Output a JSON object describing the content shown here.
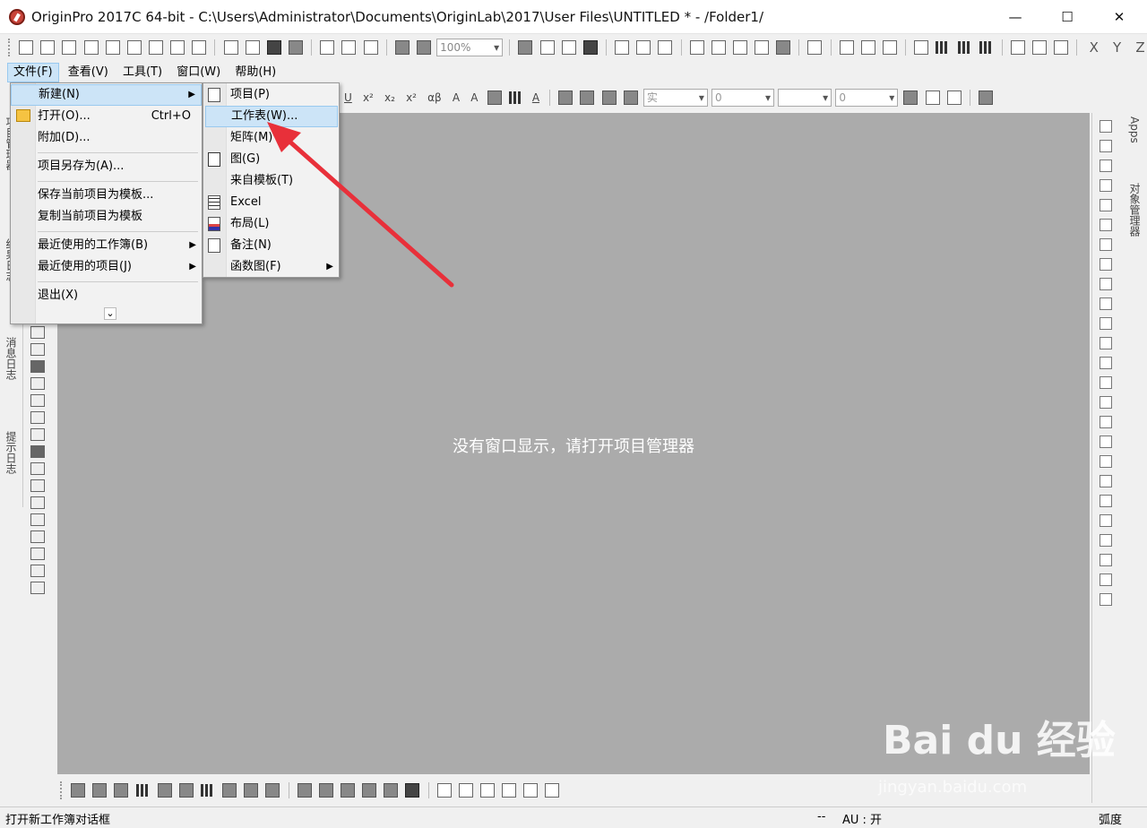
{
  "window": {
    "title": "OriginPro 2017C 64-bit - C:\\Users\\Administrator\\Documents\\OriginLab\\2017\\User Files\\UNTITLED * - /Folder1/",
    "minimize_glyph": "—",
    "maximize_glyph": "☐",
    "close_glyph": "✕"
  },
  "toolbar1": {
    "zoom_value": "100%",
    "axis_labels": [
      "X",
      "Y",
      "Z"
    ]
  },
  "menubar": {
    "items": [
      "文件(F)",
      "查看(V)",
      "工具(T)",
      "窗口(W)",
      "帮助(H)"
    ]
  },
  "toolbar2": {
    "line_style_value": "实",
    "size_field_1": "0",
    "size_field_2": "0"
  },
  "file_menu": {
    "items": [
      {
        "label": "新建(N)",
        "shortcut": "",
        "has_submenu": true
      },
      {
        "label": "打开(O)...",
        "shortcut": "Ctrl+O",
        "has_submenu": false
      },
      {
        "label": "附加(D)...",
        "shortcut": "",
        "has_submenu": false
      },
      {
        "label": "项目另存为(A)...",
        "shortcut": "",
        "has_submenu": false
      },
      {
        "label": "保存当前项目为模板...",
        "shortcut": "",
        "has_submenu": false
      },
      {
        "label": "复制当前项目为模板",
        "shortcut": "",
        "has_submenu": false
      },
      {
        "label": "最近使用的工作簿(B)",
        "shortcut": "",
        "has_submenu": true
      },
      {
        "label": "最近使用的项目(J)",
        "shortcut": "",
        "has_submenu": true
      },
      {
        "label": "退出(X)",
        "shortcut": "",
        "has_submenu": false
      }
    ],
    "expand_glyph": "⌄"
  },
  "new_submenu": {
    "items": [
      {
        "label": "项目(P)",
        "icon": "document-icon"
      },
      {
        "label": "工作表(W)...",
        "icon": "worksheet-icon"
      },
      {
        "label": "矩阵(M)",
        "icon": "matrix-icon"
      },
      {
        "label": "图(G)",
        "icon": "graph-icon"
      },
      {
        "label": "来自模板(T)",
        "icon": "template-icon"
      },
      {
        "label": "Excel",
        "icon": "excel-icon"
      },
      {
        "label": "布局(L)",
        "icon": "layout-icon"
      },
      {
        "label": "备注(N)",
        "icon": "notes-icon"
      },
      {
        "label": "函数图(F)",
        "icon": "function-plot-icon"
      }
    ]
  },
  "workspace": {
    "empty_message": "没有窗口显示，请打开项目管理器"
  },
  "left_dock": {
    "tabs": [
      "项目管理器",
      "结果日志",
      "消息日志",
      "提示日志"
    ]
  },
  "right_dock": {
    "tabs": [
      "Apps",
      "对象管理器"
    ]
  },
  "statusbar": {
    "message": "打开新工作簿对话框",
    "dashes": "--",
    "au": "AU : 开",
    "angle_unit": "弧度"
  },
  "watermark": {
    "brand": "Bai du 经验",
    "url": "jingyan.baidu.com"
  },
  "colors": {
    "workspace": "#ababab",
    "highlight": "#cce4f7",
    "highlight_border": "#99c9ef",
    "arrow": "#e8303a"
  }
}
